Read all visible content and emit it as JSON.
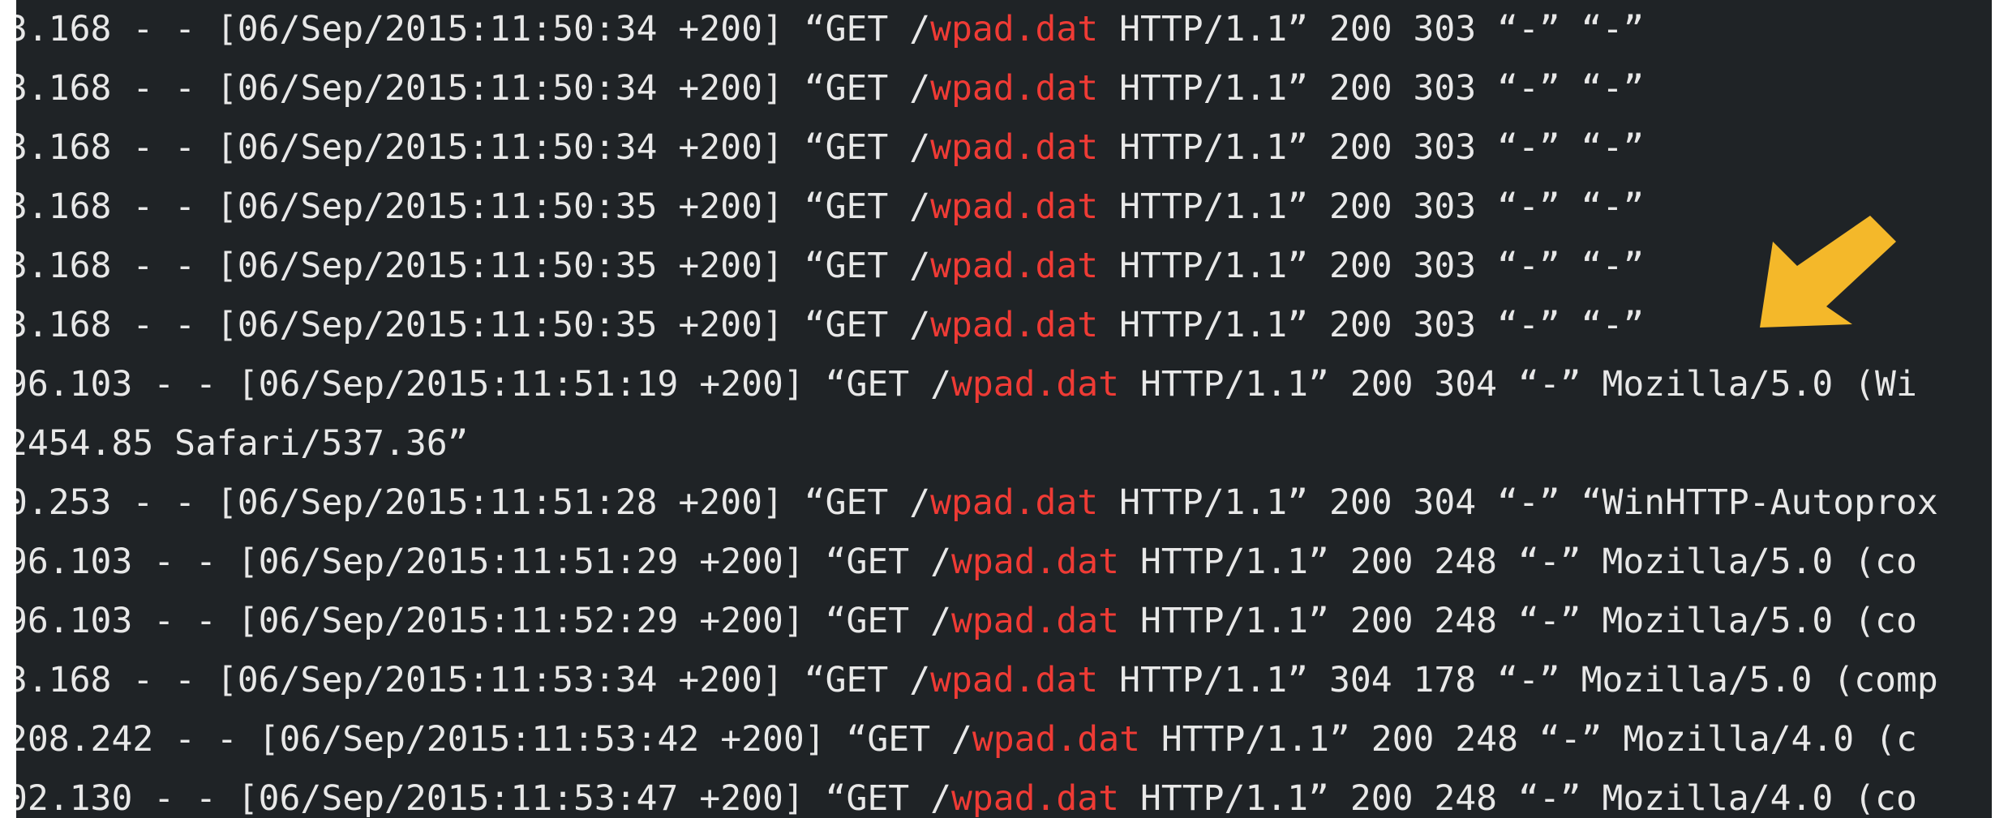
{
  "log": {
    "lines": [
      {
        "pre": "3.168 - - [06/Sep/2015:11:50:34 +200] “GET /",
        "hl": "wpad.dat",
        "post": " HTTP/1.1” 200 303 “-” “-”"
      },
      {
        "pre": "3.168 - - [06/Sep/2015:11:50:34 +200] “GET /",
        "hl": "wpad.dat",
        "post": " HTTP/1.1” 200 303 “-” “-”"
      },
      {
        "pre": "3.168 - - [06/Sep/2015:11:50:34 +200] “GET /",
        "hl": "wpad.dat",
        "post": " HTTP/1.1” 200 303 “-” “-”"
      },
      {
        "pre": "3.168 - - [06/Sep/2015:11:50:35 +200] “GET /",
        "hl": "wpad.dat",
        "post": " HTTP/1.1” 200 303 “-” “-”"
      },
      {
        "pre": "3.168 - - [06/Sep/2015:11:50:35 +200] “GET /",
        "hl": "wpad.dat",
        "post": " HTTP/1.1” 200 303 “-” “-”"
      },
      {
        "pre": "3.168 - - [06/Sep/2015:11:50:35 +200] “GET /",
        "hl": "wpad.dat",
        "post": " HTTP/1.1” 200 303 “-” “-”"
      },
      {
        "pre": "96.103 - - [06/Sep/2015:11:51:19 +200] “GET /",
        "hl": "wpad.dat",
        "post": " HTTP/1.1” 200 304 “-” Mozilla/5.0 (Wi"
      },
      {
        "pre": "2454.85 Safari/537.36”",
        "hl": "",
        "post": ""
      },
      {
        "pre": "0.253 - - [06/Sep/2015:11:51:28 +200] “GET /",
        "hl": "wpad.dat",
        "post": " HTTP/1.1” 200 304 “-” “WinHTTP-Autoprox"
      },
      {
        "pre": "96.103 - - [06/Sep/2015:11:51:29 +200] “GET /",
        "hl": "wpad.dat",
        "post": " HTTP/1.1” 200 248 “-” Mozilla/5.0 (co"
      },
      {
        "pre": "96.103 - - [06/Sep/2015:11:52:29 +200] “GET /",
        "hl": "wpad.dat",
        "post": " HTTP/1.1” 200 248 “-” Mozilla/5.0 (co"
      },
      {
        "pre": "3.168 - - [06/Sep/2015:11:53:34 +200] “GET /",
        "hl": "wpad.dat",
        "post": " HTTP/1.1” 304 178 “-” Mozilla/5.0 (comp"
      },
      {
        "pre": "208.242 - - [06/Sep/2015:11:53:42 +200] “GET /",
        "hl": "wpad.dat",
        "post": " HTTP/1.1” 200 248 “-” Mozilla/4.0 (c"
      },
      {
        "pre": "02.130 - - [06/Sep/2015:11:53:47 +200] “GET /",
        "hl": "wpad.dat",
        "post": " HTTP/1.1” 200 248 “-” Mozilla/4.0 (co"
      }
    ]
  },
  "annotation": {
    "icon": "arrow-down-left-icon",
    "color": "#f4b82a"
  },
  "colors": {
    "background": "#1f2326",
    "text": "#e8e8e8",
    "highlight": "#ef3b35"
  }
}
